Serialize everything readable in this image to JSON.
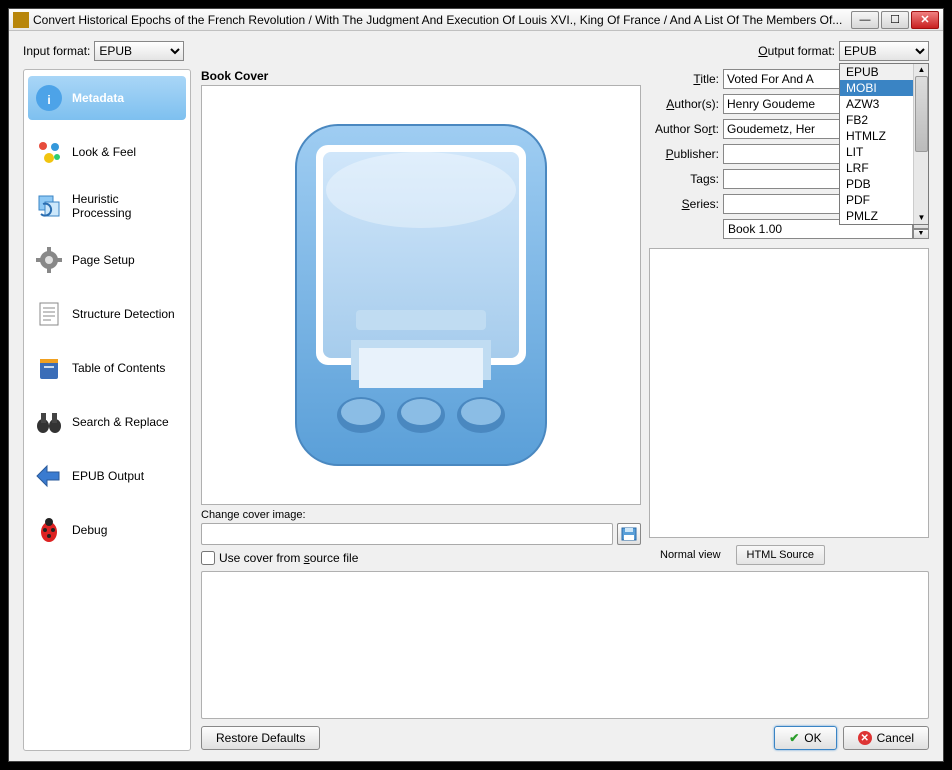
{
  "window": {
    "title": "Convert Historical Epochs of the French Revolution / With The Judgment And Execution Of Louis XVI., King Of France / And A List Of The Members Of..."
  },
  "inputFormat": {
    "label": "Input format:",
    "value": "EPUB"
  },
  "outputFormat": {
    "label": "Output format:",
    "value": "EPUB",
    "options": [
      "EPUB",
      "MOBI",
      "AZW3",
      "FB2",
      "HTMLZ",
      "LIT",
      "LRF",
      "PDB",
      "PDF",
      "PMLZ"
    ],
    "selected": "MOBI"
  },
  "sidebar": [
    {
      "label": "Metadata",
      "active": true
    },
    {
      "label": "Look & Feel"
    },
    {
      "label": "Heuristic Processing"
    },
    {
      "label": "Page Setup"
    },
    {
      "label": "Structure Detection"
    },
    {
      "label": "Table of Contents"
    },
    {
      "label": "Search & Replace"
    },
    {
      "label": "EPUB Output"
    },
    {
      "label": "Debug"
    }
  ],
  "cover": {
    "groupLabel": "Book Cover",
    "changeLabel": "Change cover image:",
    "changeValue": "",
    "useSourceLabel": "Use cover from source file",
    "useSourceChecked": false
  },
  "fields": {
    "titleLabel": "Title:",
    "titleValue": "Voted For And A",
    "authorsLabel": "Author(s):",
    "authorsValue": "Henry Goudeme",
    "authorSortLabel": "Author Sort:",
    "authorSortValue": "Goudemetz, Her",
    "publisherLabel": "Publisher:",
    "publisherValue": "",
    "tagsLabel": "Tags:",
    "tagsValue": "",
    "seriesLabel": "Series:",
    "seriesValue": "",
    "bookNumValue": "Book 1.00"
  },
  "tabs": {
    "normal": "Normal view",
    "html": "HTML Source"
  },
  "buttons": {
    "restore": "Restore Defaults",
    "ok": "OK",
    "cancel": "Cancel"
  }
}
